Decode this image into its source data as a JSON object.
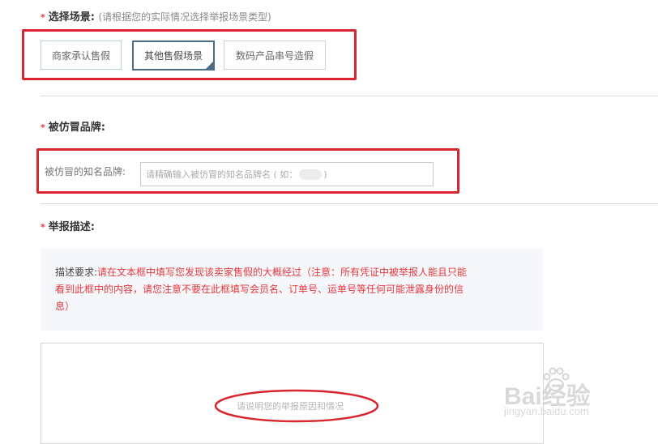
{
  "scene": {
    "required_mark": "*",
    "title": "选择场景:",
    "hint": "(请根据您的实际情况选择举报场景类型)",
    "options": [
      {
        "label": "商家承认售假",
        "selected": false
      },
      {
        "label": "其他售假场景",
        "selected": true
      },
      {
        "label": "数码产品串号造假",
        "selected": false
      }
    ]
  },
  "brand": {
    "required_mark": "*",
    "title": "被仿冒品牌:",
    "field_label": "被仿冒的知名品牌:",
    "placeholder_prefix": "请精确输入被仿冒的知名品牌名 ( 如：",
    "placeholder_suffix": ")"
  },
  "description": {
    "required_mark": "*",
    "title": "举报描述:",
    "requirement_label": "描述要求:",
    "requirement_text": "请在文本框中填写您发现该卖家售假的大概经过（注意：所有凭证中被举报人能且只能看到此框中的内容，请您注意不要在此框填写会员名、订单号、运单号等任何可能泄露身份的信息）",
    "textarea_placeholder": "请说明您的举报原因和情况"
  },
  "watermark": {
    "brand": "Bai经验",
    "url": "jingyan.baidu.com"
  },
  "colors": {
    "required": "#e4393c",
    "annotation": "#d9262e",
    "selected_border": "#4a6c86",
    "panel_bg": "#f6f7fb"
  }
}
